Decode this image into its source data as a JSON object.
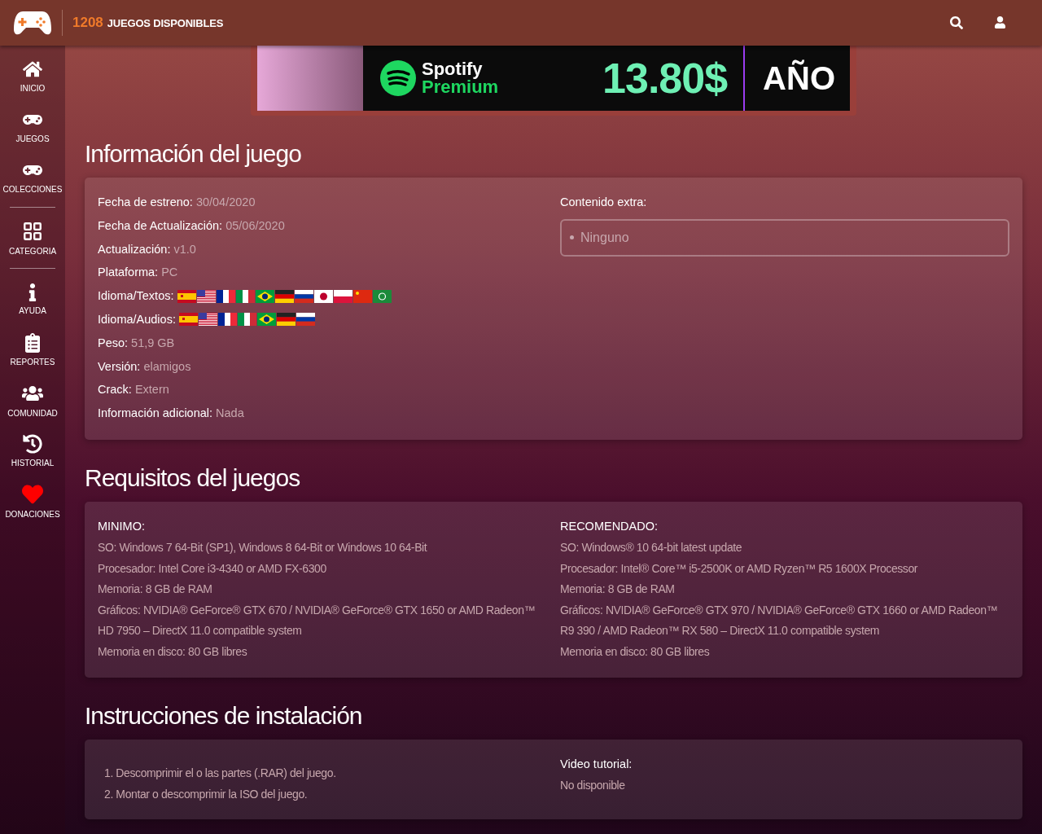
{
  "header": {
    "count": "1208",
    "label": "JUEGOS DISPONIBLES"
  },
  "sidebar": {
    "groups": [
      [
        {
          "kind": "home",
          "label": "INICIO"
        },
        {
          "kind": "gamepad",
          "label": "JUEGOS"
        },
        {
          "kind": "collections",
          "label": "COLECCIONES"
        }
      ],
      [
        {
          "kind": "grid",
          "label": "CATEGORIA"
        }
      ],
      [
        {
          "kind": "info",
          "label": "AYUDA"
        },
        {
          "kind": "clipboard",
          "label": "REPORTES"
        },
        {
          "kind": "users",
          "label": "COMUNIDAD"
        },
        {
          "kind": "history",
          "label": "HISTORIAL"
        },
        {
          "kind": "heart",
          "label": "DONACIONES"
        }
      ]
    ]
  },
  "banner": {
    "brand": "Spotify",
    "product": "Premium",
    "price": "13.80$",
    "period": "AÑO"
  },
  "game_info": {
    "title": "Información del juego",
    "fields": [
      {
        "label": "Fecha de estreno:",
        "value": "30/04/2020"
      },
      {
        "label": "Fecha de Actualización:",
        "value": "05/06/2020"
      },
      {
        "label": "Actualización:",
        "value": "v1.0"
      },
      {
        "label": "Plataforma:",
        "value": "PC"
      },
      {
        "label": "Idioma/Textos:",
        "flags": [
          {
            "kind": "es"
          },
          {
            "kind": "us"
          },
          {
            "kind": "fr"
          },
          {
            "kind": "it"
          },
          {
            "kind": "br"
          },
          {
            "kind": "de"
          },
          {
            "kind": "ru"
          },
          {
            "kind": "jp"
          },
          {
            "kind": "pl"
          },
          {
            "kind": "cn"
          },
          {
            "kind": "sa"
          }
        ]
      },
      {
        "label": "Idioma/Audios:",
        "flags": [
          {
            "kind": "es"
          },
          {
            "kind": "us"
          },
          {
            "kind": "fr"
          },
          {
            "kind": "it"
          },
          {
            "kind": "br"
          },
          {
            "kind": "de"
          },
          {
            "kind": "ru"
          }
        ]
      },
      {
        "label": "Peso:",
        "value": "51,9 GB"
      },
      {
        "label": "Versión:",
        "value": "elamigos"
      },
      {
        "label": "Crack:",
        "value": "Extern"
      },
      {
        "label": "Información adicional:",
        "value": "Nada"
      }
    ],
    "extra_label": "Contenido extra:",
    "extra_items": [
      "Ninguno"
    ]
  },
  "requirements": {
    "title": "Requisitos del juegos",
    "columns": [
      {
        "heading": "MINIMO:",
        "lines": [
          "SO: Windows 7 64-Bit (SP1), Windows 8 64-Bit or Windows 10 64-Bit",
          "Procesador: Intel Core i3-4340 or AMD FX-6300",
          "Memoria: 8 GB de RAM",
          "Gráficos: NVIDIA® GeForce® GTX 670 / NVIDIA® GeForce® GTX 1650 or AMD Radeon™ HD 7950 – DirectX 11.0 compatible system",
          "Memoria en disco: 80 GB libres"
        ]
      },
      {
        "heading": "RECOMENDADO:",
        "lines": [
          "SO: Windows® 10 64-bit latest update",
          "Procesador: Intel® Core™ i5-2500K or AMD Ryzen™ R5 1600X Processor",
          "Memoria: 8 GB de RAM",
          "Gráficos: NVIDIA® GeForce® GTX 970 / NVIDIA® GeForce® GTX 1660 or AMD Radeon™ R9 390 / AMD Radeon™ RX 580 – DirectX 11.0 compatible system",
          "Memoria en disco: 80 GB libres"
        ]
      }
    ]
  },
  "install": {
    "title": "Instrucciones de instalación",
    "steps": [
      "1. Descomprimir el o las partes (.RAR) del juego.",
      "2. Montar o descomprimir la ISO del juego."
    ],
    "video_label": "Video tutorial:",
    "video_value": "No disponible"
  }
}
